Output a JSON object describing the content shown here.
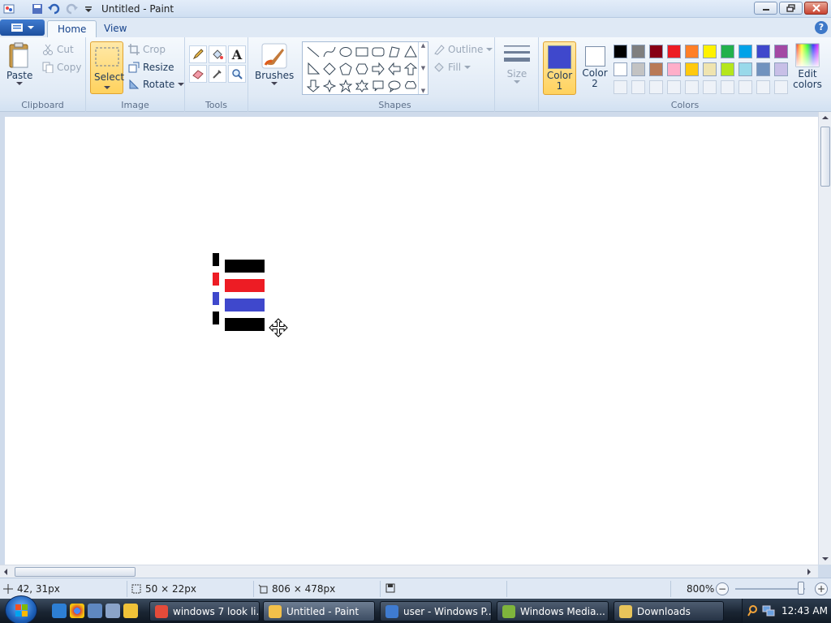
{
  "window": {
    "title": "Untitled - Paint"
  },
  "tabs": [
    {
      "label": "Home"
    },
    {
      "label": "View"
    }
  ],
  "ribbon": {
    "clipboard": {
      "label": "Clipboard",
      "paste": "Paste",
      "cut": "Cut",
      "copy": "Copy"
    },
    "image": {
      "label": "Image",
      "select": "Select",
      "crop": "Crop",
      "resize": "Resize",
      "rotate": "Rotate"
    },
    "tools": {
      "label": "Tools"
    },
    "brushes": {
      "label": "Brushes"
    },
    "shapes": {
      "label": "Shapes",
      "outline": "Outline",
      "fill": "Fill"
    },
    "size": {
      "label": "Size"
    },
    "colors": {
      "label": "Colors",
      "color1_line1": "Color",
      "color1_line2": "1",
      "color2_line1": "Color",
      "color2_line2": "2",
      "edit_line1": "Edit",
      "edit_line2": "colors",
      "color1_value": "#3f48cc",
      "color2_value": "#ffffff",
      "palette": [
        "#000000",
        "#7f7f7f",
        "#880015",
        "#ed1c24",
        "#ff7f27",
        "#fff200",
        "#22b14c",
        "#00a2e8",
        "#3f48cc",
        "#a349a4",
        "#ffffff",
        "#c3c3c3",
        "#b97a57",
        "#ffaec9",
        "#ffc90e",
        "#efe4b0",
        "#b5e61d",
        "#99d9ea",
        "#7092be",
        "#c8bfe7",
        "",
        "",
        "",
        "",
        "",
        "",
        "",
        "",
        "",
        ""
      ]
    }
  },
  "canvas": {
    "strokes": [
      {
        "color": "#000000"
      },
      {
        "color": "#ed1c24"
      },
      {
        "color": "#3f48cc"
      },
      {
        "color": "#000000"
      }
    ]
  },
  "status": {
    "cursor_pos": "42, 31px",
    "selection_size": "50 × 22px",
    "image_size": "806 × 478px",
    "zoom": "800%"
  },
  "taskbar": {
    "tasks": [
      {
        "label": "windows 7 look li...",
        "icon_color": "#e44b3a"
      },
      {
        "label": "Untitled - Paint",
        "icon_color": "#f2c04a"
      },
      {
        "label": "user - Windows P...",
        "icon_color": "#3f7bd0"
      },
      {
        "label": "Windows Media...",
        "icon_color": "#7fb43c"
      },
      {
        "label": "Downloads",
        "icon_color": "#e8c45a"
      }
    ],
    "clock": "12:43 AM"
  }
}
